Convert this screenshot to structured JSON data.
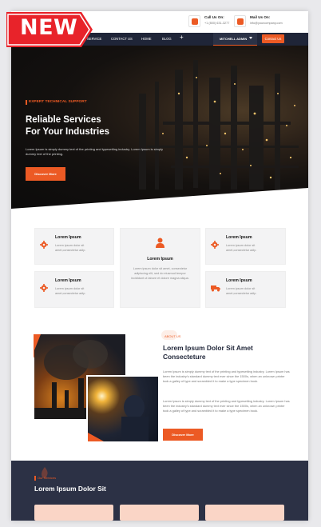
{
  "badge": {
    "label": "NEW"
  },
  "topbar": {
    "call": {
      "title": "Call Us On:",
      "value": "+1 (800) 631-3277"
    },
    "mail": {
      "title": "Mail Us On:",
      "value": "info@yourcompany.com"
    }
  },
  "nav": {
    "items": [
      "SERVICE",
      "CONTACT US",
      "HOME",
      "BLOG"
    ],
    "plus": "+",
    "admin": "MITCHELL ADMIN",
    "contact_btn": "Contact Us"
  },
  "hero": {
    "eyebrow": "EXPERT TECHNICAL SUPPORT",
    "title_line1": "Reliable Services",
    "title_line2": "For Your Industries",
    "description": "Lorem Ipsum is simply dummy text of the printing and typesetting industry. Lorem Ipsum is simply dummy text of the printing.",
    "button": "Discover More"
  },
  "features": [
    {
      "title": "Lorem Ipsum",
      "desc": "Lorem ipsum dolor sit amet,consectetur adip.",
      "icon": "gear-icon"
    },
    {
      "title": "Lorem Ipsum",
      "desc": "Lorem ipsum dolor sit amet,consectetur adip.",
      "icon": "gear-icon"
    },
    {
      "title": "Lorem Ipsum",
      "desc": "Lorem ipsum dolor sit amet,consectetur adip.",
      "icon": "gear-icon"
    },
    {
      "title": "Lorem Ipsum",
      "desc": "Lorem ipsum dolor sit amet,consectetur adip.",
      "icon": "truck-icon"
    },
    {
      "title": "Lorem Ipsum",
      "desc": "Lorem ipsum dolor sit amet, consectetur adipiscing elit, sed do eiusmod tempor incididunt ut labore et dolore magna aliqua.",
      "icon": "user-icon"
    }
  ],
  "about": {
    "tag": "ABOUT US",
    "title": "Lorem Ipsum Dolor Sit Amet Consecteture",
    "para1": "Lorem Ipsum is simply dummy text of the printing and typesetting industry. Lorem Ipsum has been the industry's standard dummy text ever since the 1500s, when an unknown printer took a galley of type and scrambled it to make a type specimen book.",
    "para2": "Lorem Ipsum is simply dummy text of the printing and typesetting industry. Lorem Ipsum has been the industry's standard dummy text ever since the 1500s, when an unknown printer took a galley of type and scrambled it to make a type specimen book.",
    "button": "Discover More"
  },
  "section2": {
    "tag": "Our Services",
    "title": "Lorem Ipsum Dolor Sit"
  },
  "colors": {
    "accent": "#ec5a24",
    "navy": "#1f2538",
    "badge_red": "#e8232a"
  }
}
